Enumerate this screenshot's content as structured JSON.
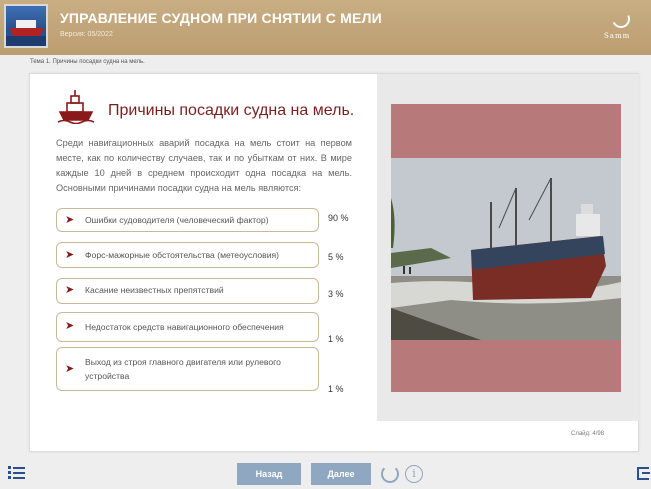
{
  "header": {
    "title": "УПРАВЛЕНИЕ СУДНОМ ПРИ СНЯТИИ С МЕЛИ",
    "version": "Версия: 05/2022",
    "brand": "Samm"
  },
  "breadcrumb": "Тема 1. Причины посадки судна на мель.",
  "slide": {
    "title": "Причины посадки судна на мель.",
    "intro": "Среди навигационных аварий посадка на мель стоит на первом месте, как по количеству случаев, так и по убыткам от них. В мире каждые 10 дней в среднем происходит одна посадка на мель. Основными причинами посадки судна на мель являются:",
    "causes": [
      {
        "label": "Ошибки судоводителя (человеческий фактор)",
        "percent": "90 %"
      },
      {
        "label": "Форс-мажорные обстоятельства (метеоусловия)",
        "percent": "5 %"
      },
      {
        "label": "Касание неизвестных препятствий",
        "percent": "3 %"
      },
      {
        "label": "Недостаток средств навигационного обеспечения",
        "percent": "1 %"
      },
      {
        "label": "Выход из строя главного двигателя или рулевого устройства",
        "percent": "1 %"
      }
    ],
    "counter": "Слайд: 4/98"
  },
  "footer": {
    "back": "Назад",
    "next": "Далее"
  },
  "colors": {
    "header_bg": "#c4a77b",
    "accent": "#7a1f1f",
    "nav_button": "#8fa7c1",
    "photo_frame": "#b8797b"
  }
}
